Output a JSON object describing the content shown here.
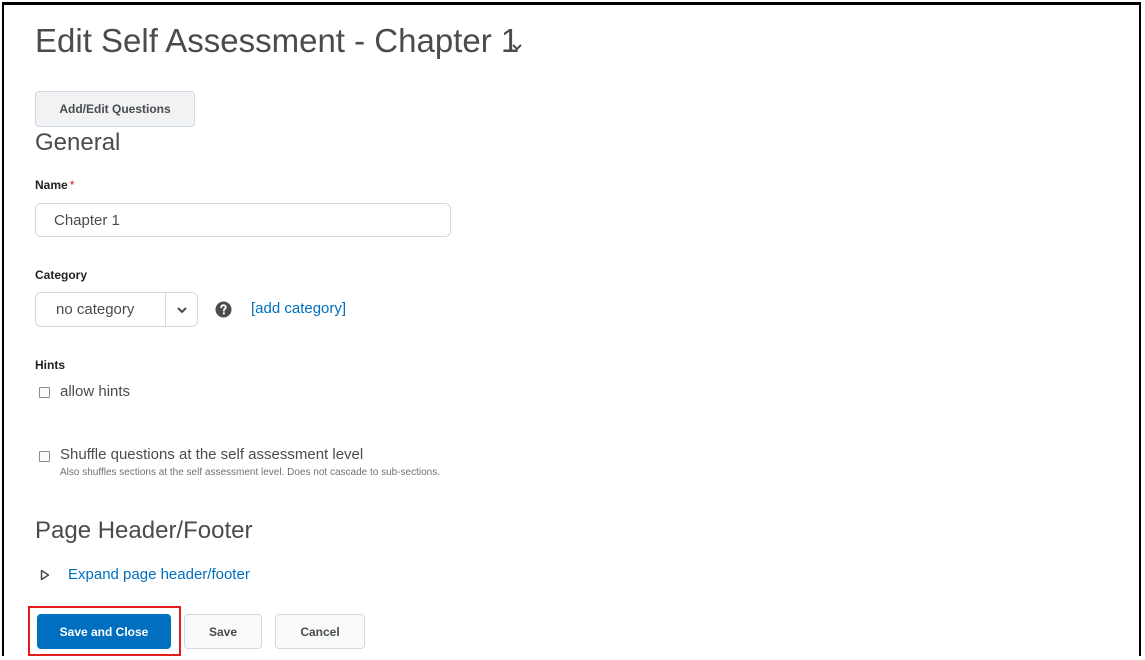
{
  "page": {
    "title": "Edit Self Assessment - Chapter 1"
  },
  "toolbar": {
    "add_edit_questions_label": "Add/Edit Questions"
  },
  "general": {
    "heading": "General",
    "name": {
      "label": "Name",
      "required_marker": "*",
      "value": "Chapter 1"
    },
    "category": {
      "label": "Category",
      "selected": "no category",
      "add_link": "[add category]"
    },
    "hints": {
      "label": "Hints",
      "checkbox_label": "allow hints",
      "checked": false
    },
    "shuffle": {
      "checkbox_label": "Shuffle questions at the self assessment level",
      "description": "Also shuffles sections at the self assessment level. Does not cascade to sub-sections.",
      "checked": false
    }
  },
  "header_footer": {
    "heading": "Page Header/Footer",
    "expand_link": "Expand page header/footer"
  },
  "actions": {
    "save_and_close": "Save and Close",
    "save": "Save",
    "cancel": "Cancel"
  },
  "colors": {
    "primary": "#006fbf",
    "link": "#006fbf",
    "text": "#494c4e",
    "highlight": "#e21b1b"
  },
  "icons": {
    "title_menu": "chevron-down-icon",
    "select_arrow": "chevron-down-icon",
    "help": "question-circle-icon",
    "expand": "triangle-right-icon"
  }
}
